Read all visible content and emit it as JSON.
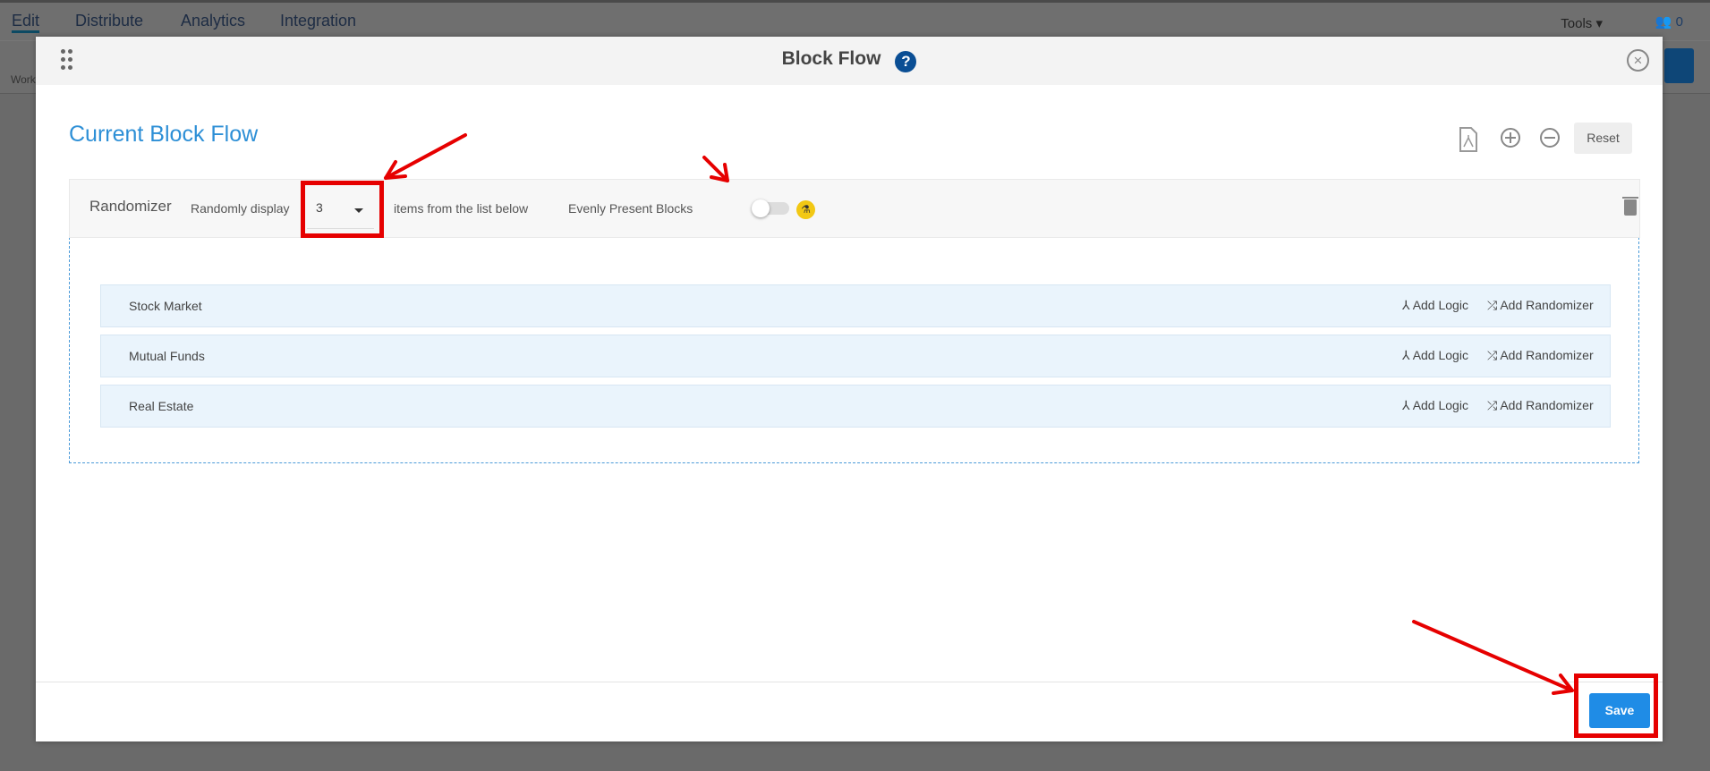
{
  "topnav": {
    "items": [
      "Edit",
      "Distribute",
      "Analytics",
      "Integration"
    ],
    "tools": "Tools",
    "users_count": "0",
    "toolbar_label": "Work"
  },
  "modal": {
    "title": "Block Flow",
    "help": "?",
    "close": "×"
  },
  "content": {
    "heading": "Current Block Flow",
    "reset": "Reset"
  },
  "randomizer": {
    "label": "Randomizer",
    "prefix": "Randomly display",
    "count": "3",
    "suffix": "items from the list below",
    "evenly_label": "Evenly Present Blocks",
    "evenly_on": false
  },
  "blocks": [
    {
      "name": "Stock Market",
      "add_logic": "Add Logic",
      "add_randomizer": "Add Randomizer"
    },
    {
      "name": "Mutual Funds",
      "add_logic": "Add Logic",
      "add_randomizer": "Add Randomizer"
    },
    {
      "name": "Real Estate",
      "add_logic": "Add Logic",
      "add_randomizer": "Add Randomizer"
    }
  ],
  "footer": {
    "save": "Save"
  },
  "colors": {
    "accent": "#1f8ce6",
    "annotation": "#e60000",
    "heading": "#2d8fd6"
  }
}
